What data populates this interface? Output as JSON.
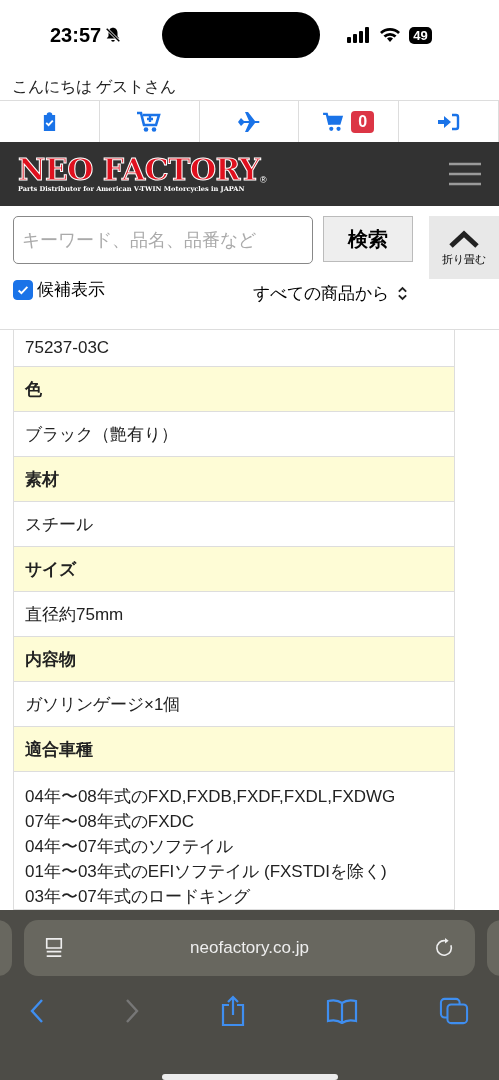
{
  "status_bar": {
    "time": "23:57",
    "battery": "49"
  },
  "greeting": "こんにちは ゲストさん",
  "nav": {
    "cart_count": "0"
  },
  "logo": {
    "title": "NEO FACTORY",
    "mark": "®",
    "tagline": "Parts Distributor for American V-TWIN Motorcycles in JAPAN"
  },
  "search": {
    "placeholder": "キーワード、品名、品番など",
    "button": "検索",
    "collapse": "折り畳む",
    "suggest_label": "候補表示",
    "suggest_checked": true,
    "scope": "すべての商品から"
  },
  "spec_table": [
    {
      "kind": "value",
      "lines": [
        "75237-03C"
      ]
    },
    {
      "kind": "label",
      "lines": [
        "色"
      ]
    },
    {
      "kind": "value",
      "lines": [
        "ブラック（艶有り）"
      ]
    },
    {
      "kind": "label",
      "lines": [
        "素材"
      ]
    },
    {
      "kind": "value",
      "lines": [
        "スチール"
      ]
    },
    {
      "kind": "label",
      "lines": [
        "サイズ"
      ]
    },
    {
      "kind": "value",
      "lines": [
        "直径約75mm"
      ]
    },
    {
      "kind": "label",
      "lines": [
        "内容物"
      ]
    },
    {
      "kind": "value",
      "lines": [
        "ガソリンゲージ×1個"
      ]
    },
    {
      "kind": "label",
      "lines": [
        "適合車種"
      ]
    },
    {
      "kind": "value",
      "lines": [
        "04年〜08年式のFXD,FXDB,FXDF,FXDL,FXDWG",
        "07年〜08年式のFXDC",
        "04年〜07年式のソフテイル",
        "01年〜03年式のEFIソフテイル (FXSTDIを除く)",
        "03年〜07年式のロードキング"
      ]
    }
  ],
  "browser": {
    "url": "neofactory.co.jp"
  }
}
